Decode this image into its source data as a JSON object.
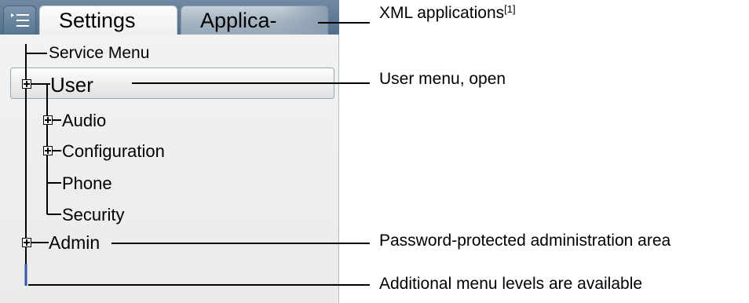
{
  "tabs": [
    {
      "label": "Settings",
      "active": true
    },
    {
      "label": "Applica-",
      "active": false
    }
  ],
  "tree": {
    "service_menu": "Service Menu",
    "user": "User",
    "user_children": [
      "Audio",
      "Configuration",
      "Phone",
      "Security"
    ],
    "admin": "Admin"
  },
  "callouts": {
    "xml_applications": "XML applications",
    "xml_footnote": "[1]",
    "user_menu": "User menu, open",
    "admin_area": "Password-protected administration area",
    "more_levels": "Additional menu levels are available"
  },
  "colors": {
    "tab_bar": "#5f7a94",
    "scroll_indicator": "#3a52a8",
    "screen_background": "#eef0f0"
  }
}
